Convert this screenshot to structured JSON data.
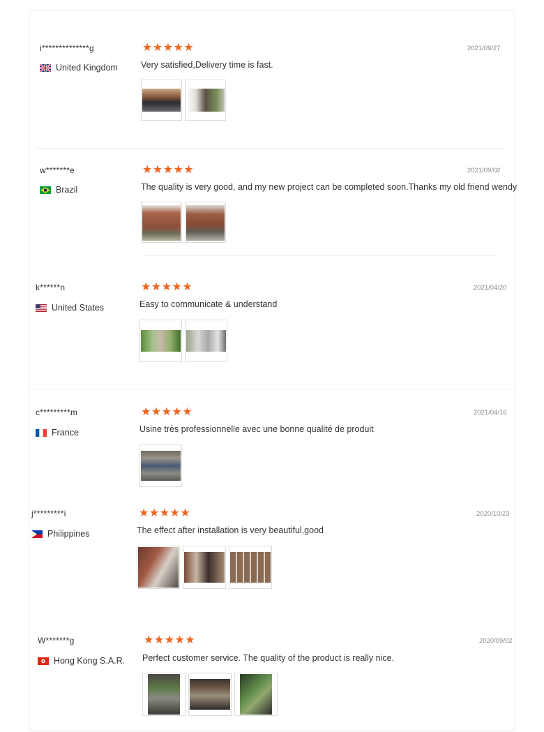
{
  "reviews": [
    {
      "user": "i**************g",
      "country": "United Kingdom",
      "flag": "uk",
      "rating": 5,
      "stars": "★★★★★",
      "date": "2021/09/27",
      "comment": "Very satisfied,Delivery time is fast.",
      "photos": [
        "warehouse",
        "warehouse-2"
      ]
    },
    {
      "user": "w*******e",
      "country": "Brazil",
      "flag": "brazil",
      "rating": 5,
      "stars": "★★★★★",
      "date": "2021/09/02",
      "comment": "The quality is very good, and my new project can be completed soon.Thanks my old friend wendy",
      "photos": [
        "building",
        "building-2"
      ]
    },
    {
      "user": "k******n",
      "country": "United States",
      "flag": "us",
      "rating": 5,
      "stars": "★★★★★",
      "date": "2021/04/20",
      "comment": "Easy to communicate & understand",
      "photos": [
        "trees",
        "interior"
      ]
    },
    {
      "user": "c*********m",
      "country": "France",
      "flag": "france",
      "rating": 5,
      "stars": "★★★★★",
      "date": "2021/04/16",
      "comment": "Usine très professionnelle avec une bonne qualité de produit",
      "photos": [
        "factory"
      ]
    },
    {
      "user": "j*********i",
      "country": "Philippines",
      "flag": "philippines",
      "rating": 5,
      "stars": "★★★★★",
      "date": "2020/10/23",
      "comment": "The effect after installation is very beautiful,good",
      "photos": [
        "porch",
        "glass-room",
        "window-grid"
      ]
    },
    {
      "user": "W*******g",
      "country": "Hong Kong S.A.R.",
      "flag": "hongkong",
      "rating": 5,
      "stars": "★★★★★",
      "date": "2020/09/02",
      "comment": "Perfect customer service. The quality of the product is really nice.",
      "photos": [
        "patio",
        "patio-2",
        "garden"
      ]
    }
  ]
}
